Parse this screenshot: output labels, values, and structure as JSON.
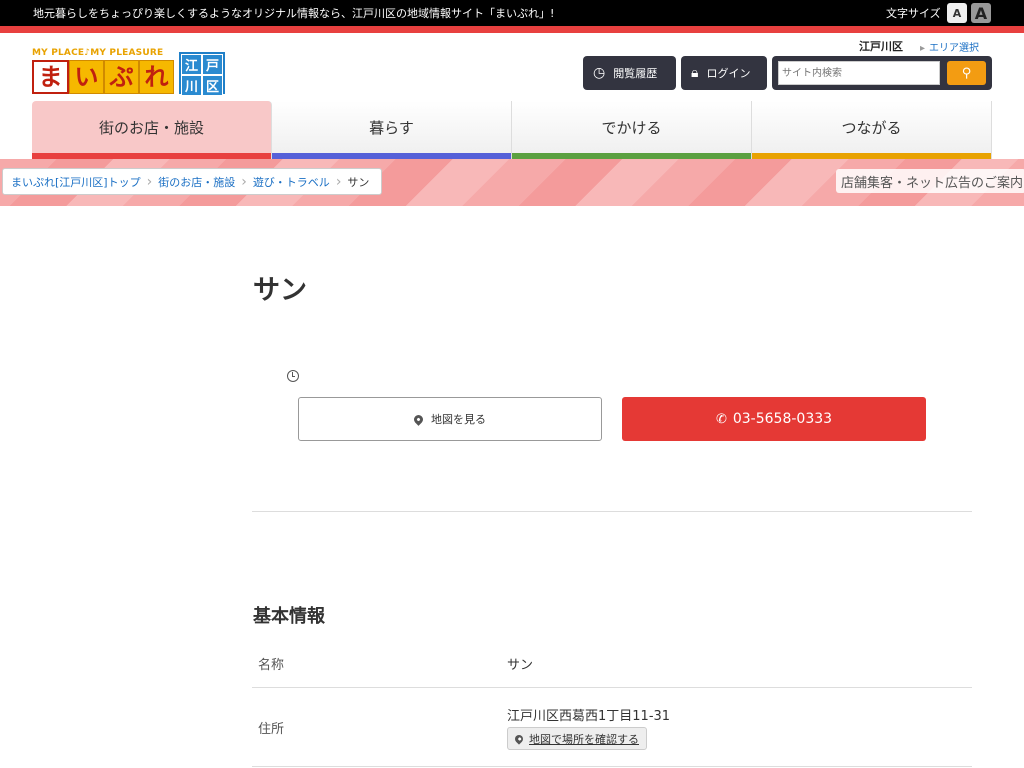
{
  "topbar": {
    "tagline": "地元暮らしをちょっぴり楽しくするようなオリジナル情報なら、江戸川区の地域情報サイト「まいぷれ」!",
    "font_size_label": "文字サイズ",
    "font_small": "A",
    "font_large": "A"
  },
  "logo": {
    "slogan": "MY PLACE♪MY PLEASURE",
    "chars": [
      "ま",
      "い",
      "ぷ",
      "れ"
    ],
    "area_chars": [
      "江",
      "戸",
      "川",
      "区"
    ]
  },
  "header": {
    "area_name": "江戸川区",
    "area_select": "エリア選択",
    "history_label": "閲覧履歴",
    "login_label": "ログイン",
    "search_placeholder": "サイト内検索"
  },
  "nav": {
    "items": [
      {
        "label": "街のお店・施設",
        "color": "#e8403f"
      },
      {
        "label": "暮らす",
        "color": "#5560d8"
      },
      {
        "label": "でかける",
        "color": "#5aa040"
      },
      {
        "label": "つながる",
        "color": "#e8a200"
      }
    ]
  },
  "breadcrumb": {
    "items": [
      "まいぷれ[江戸川区]トップ",
      "街のお店・施設",
      "遊び・トラベル",
      "サン"
    ]
  },
  "ad_link": "店舗集客・ネット広告のご案内",
  "main": {
    "title": "サン",
    "map_button": "地図を見る",
    "phone": "03-5658-0333"
  },
  "basic_info": {
    "title": "基本情報",
    "rows": [
      {
        "label": "名称",
        "value": "サン"
      },
      {
        "label": "住所",
        "value": "江戸川区西葛西1丁目11-31",
        "link": "地図で場所を確認する"
      }
    ]
  },
  "colors": {
    "accent_red": "#e53935",
    "header_dark": "#333440",
    "search_orange": "#f39c12"
  }
}
